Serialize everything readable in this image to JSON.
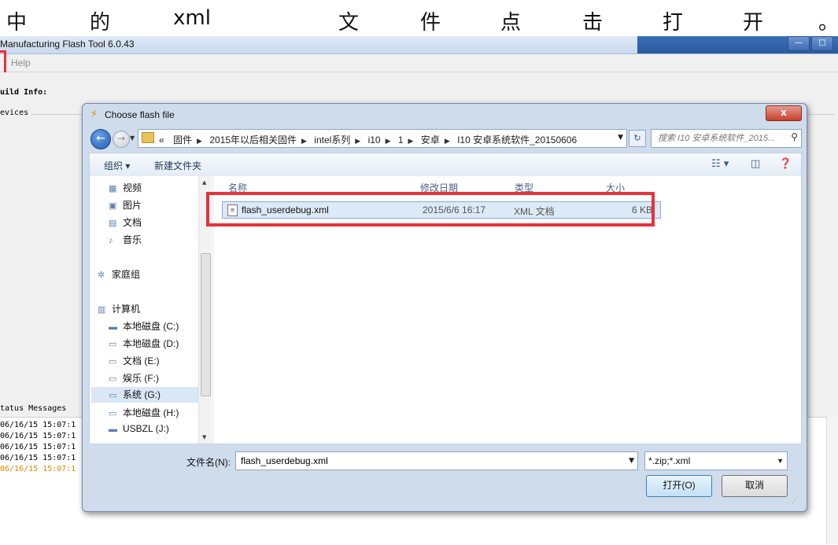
{
  "caption": {
    "chars": [
      "中",
      "的",
      "xml",
      "文",
      "件",
      "点",
      "击",
      "打",
      "开",
      "。"
    ]
  },
  "app": {
    "title": "Manufacturing Flash Tool 6.0.43",
    "menu_help": "Help",
    "build_info": "uild Info:",
    "devices": "evices",
    "status_title": "tatus Messages",
    "status_lines": [
      {
        "text": "06/16/15 15:07:1",
        "color": "#222222"
      },
      {
        "text": "06/16/15 15:07:1",
        "color": "#222222"
      },
      {
        "text": "06/16/15 15:07:1",
        "color": "#222222"
      },
      {
        "text": "06/16/15 15:07:1",
        "color": "#222222"
      },
      {
        "text": "06/16/15 15:07:1",
        "color": "#e08a00"
      }
    ]
  },
  "dialog": {
    "title": "Choose flash file",
    "close_label": "x",
    "breadcrumbs": [
      "«",
      "固件",
      "2015年以后相关固件",
      "intel系列",
      "i10",
      "1",
      "安卓",
      "I10 安卓系统软件_20150606"
    ],
    "search_placeholder": "搜索 I10 安卓系统软件_2015...",
    "toolbar": {
      "organize": "组织 ▾",
      "new_folder": "新建文件夹"
    },
    "nav_items": [
      {
        "label": "视频",
        "icon": "video-icon"
      },
      {
        "label": "图片",
        "icon": "picture-icon"
      },
      {
        "label": "文档",
        "icon": "document-icon"
      },
      {
        "label": "音乐",
        "icon": "music-icon"
      },
      {
        "label": "家庭组",
        "icon": "homegroup-icon"
      },
      {
        "label": "计算机",
        "icon": "computer-icon"
      },
      {
        "label": "本地磁盘 (C:)",
        "icon": "drive-icon"
      },
      {
        "label": "本地磁盘 (D:)",
        "icon": "drive-icon"
      },
      {
        "label": "文档 (E:)",
        "icon": "drive-icon"
      },
      {
        "label": "娱乐 (F:)",
        "icon": "drive-icon"
      },
      {
        "label": "系统 (G:)",
        "icon": "drive-icon"
      },
      {
        "label": "本地磁盘 (H:)",
        "icon": "drive-icon"
      },
      {
        "label": "USBZL (J:)",
        "icon": "usb-icon"
      }
    ],
    "columns": [
      "名称",
      "修改日期",
      "类型",
      "大小"
    ],
    "files": [
      {
        "name": "flash_userdebug.xml",
        "date": "2015/6/6 16:17",
        "type": "XML 文档",
        "size": "6 KB"
      }
    ],
    "filename_label": "文件名(N):",
    "filename_value": "flash_userdebug.xml",
    "filetype_value": "*.zip;*.xml",
    "open_button": "打开(O)",
    "cancel_button": "取消"
  },
  "colors": {
    "highlight_red": "#e8313c",
    "selection_blue": "#dce9f7"
  }
}
